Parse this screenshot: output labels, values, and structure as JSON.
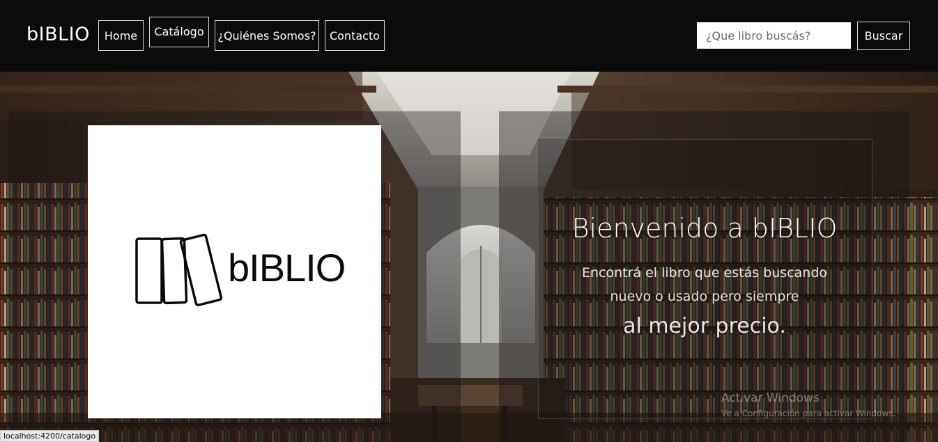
{
  "navbar": {
    "brand": "bIBLIO",
    "items": [
      {
        "label": "Home"
      },
      {
        "label": "Catálogo"
      },
      {
        "label": "¿Quiénes Somos?"
      },
      {
        "label": "Contacto"
      }
    ],
    "search": {
      "placeholder": "¿Que libro buscás?",
      "value": ""
    },
    "search_button": "Buscar"
  },
  "hero": {
    "logo_text": "bIBLIO",
    "title": "Bienvenido a bIBLIO",
    "line1": "Encontrá el libro que estás buscando",
    "line2": "nuevo o usado pero siempre",
    "line3": "al mejor precio."
  },
  "watermark": {
    "title": "Activar Windows",
    "subtitle": "Ve a Configuración para activar Windows."
  },
  "status_bar": {
    "url": "localhost:4200/catalogo"
  },
  "colors": {
    "navbar_bg": "#0b0b0b",
    "text": "#ffffff"
  }
}
